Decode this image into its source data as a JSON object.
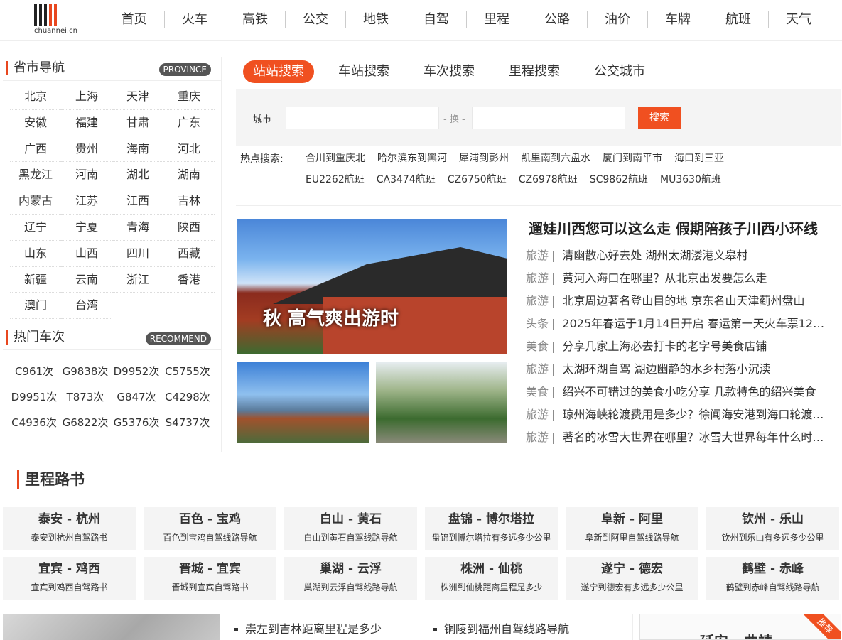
{
  "header": {
    "logo_text": "chuannei.cn",
    "nav": [
      "首页",
      "火车",
      "高铁",
      "公交",
      "地铁",
      "自驾",
      "里程",
      "公路",
      "油价",
      "车牌",
      "航班",
      "天气"
    ]
  },
  "provinces": {
    "title": "省市导航",
    "badge": "PROVINCE",
    "items": [
      "北京",
      "上海",
      "天津",
      "重庆",
      "安徽",
      "福建",
      "甘肃",
      "广东",
      "广西",
      "贵州",
      "海南",
      "河北",
      "黑龙江",
      "河南",
      "湖北",
      "湖南",
      "内蒙古",
      "江苏",
      "江西",
      "吉林",
      "辽宁",
      "宁夏",
      "青海",
      "陕西",
      "山东",
      "山西",
      "四川",
      "西藏",
      "新疆",
      "云南",
      "浙江",
      "香港",
      "澳门",
      "台湾"
    ]
  },
  "trains": {
    "title": "热门车次",
    "badge": "RECOMMEND",
    "items": [
      "C961次",
      "G9838次",
      "D9952次",
      "C5755次",
      "D9951次",
      "T873次",
      "G847次",
      "C4298次",
      "C4936次",
      "G6822次",
      "G5376次",
      "S4737次"
    ]
  },
  "search": {
    "tabs": [
      "站站搜索",
      "车站搜索",
      "车次搜索",
      "里程搜索",
      "公交城市"
    ],
    "city_label": "城市",
    "swap_text": "- 换 -",
    "button": "搜索",
    "hot_label": "热点搜索:",
    "hot_links": [
      "合川到重庆北",
      "哈尔滨东到黑河",
      "犀浦到彭州",
      "凯里南到六盘水",
      "厦门到南平市",
      "海口到三亚",
      "EU2262航班",
      "CA3474航班",
      "CZ6750航班",
      "CZ6978航班",
      "SC9862航班",
      "MU3630航班"
    ]
  },
  "feature": {
    "image_caption": "秋 高气爽出游时",
    "headline": "遛娃川西您可以这么走 假期陪孩子川西小环线",
    "news": [
      {
        "cat": "旅游",
        "title": "清幽散心好去处 湖州太湖溇港义皋村"
      },
      {
        "cat": "旅游",
        "title": "黄河入海口在哪里？从北京出发要怎么走"
      },
      {
        "cat": "旅游",
        "title": "北京周边著名登山目的地 京东名山天津蓟州盘山"
      },
      {
        "cat": "头条",
        "title": "2025年春运于1月14日开启 春运第一天火车票12月..."
      },
      {
        "cat": "美食",
        "title": "分享几家上海必去打卡的老字号美食店铺"
      },
      {
        "cat": "旅游",
        "title": "太湖环湖自驾 湖边幽静的水乡村落小沉渎"
      },
      {
        "cat": "美食",
        "title": "绍兴不可错过的美食小吃分享 几款特色的绍兴美食"
      },
      {
        "cat": "旅游",
        "title": "琼州海峡轮渡费用是多少？徐闻海安港到海口轮渡要..."
      },
      {
        "cat": "旅游",
        "title": "著名的冰雪大世界在哪里？冰雪大世界每年什么时候..."
      }
    ]
  },
  "routes": {
    "title": "里程路书",
    "items": [
      {
        "name": "泰安 - 杭州",
        "desc": "泰安到杭州自驾路书"
      },
      {
        "name": "百色 - 宝鸡",
        "desc": "百色到宝鸡自驾线路导航"
      },
      {
        "name": "白山 - 黄石",
        "desc": "白山到黄石自驾线路导航"
      },
      {
        "name": "盘锦 - 博尔塔拉",
        "desc": "盘锦到博尔塔拉有多远多少公里"
      },
      {
        "name": "阜新 - 阿里",
        "desc": "阜新到阿里自驾线路导航"
      },
      {
        "name": "钦州 - 乐山",
        "desc": "钦州到乐山有多远多少公里"
      },
      {
        "name": "宜宾 - 鸡西",
        "desc": "宜宾到鸡西自驾路书"
      },
      {
        "name": "晋城 - 宜宾",
        "desc": "晋城到宜宾自驾路书"
      },
      {
        "name": "巢湖 - 云浮",
        "desc": "巢湖到云浮自驾线路导航"
      },
      {
        "name": "株洲 - 仙桃",
        "desc": "株洲到仙桃距离里程是多少"
      },
      {
        "name": "遂宁 - 德宏",
        "desc": "遂宁到德宏有多远多少公里"
      },
      {
        "name": "鹤壁 - 赤峰",
        "desc": "鹤壁到赤峰自驾线路导航"
      }
    ]
  },
  "bottom": {
    "links": [
      "崇左到吉林距离里程是多少",
      "铜陵到福州自驾线路导航"
    ],
    "ribbon": "推荐",
    "map_text": "延安 - 曲靖"
  },
  "colors": {
    "accent": "#f05020",
    "badge": "#555555"
  }
}
